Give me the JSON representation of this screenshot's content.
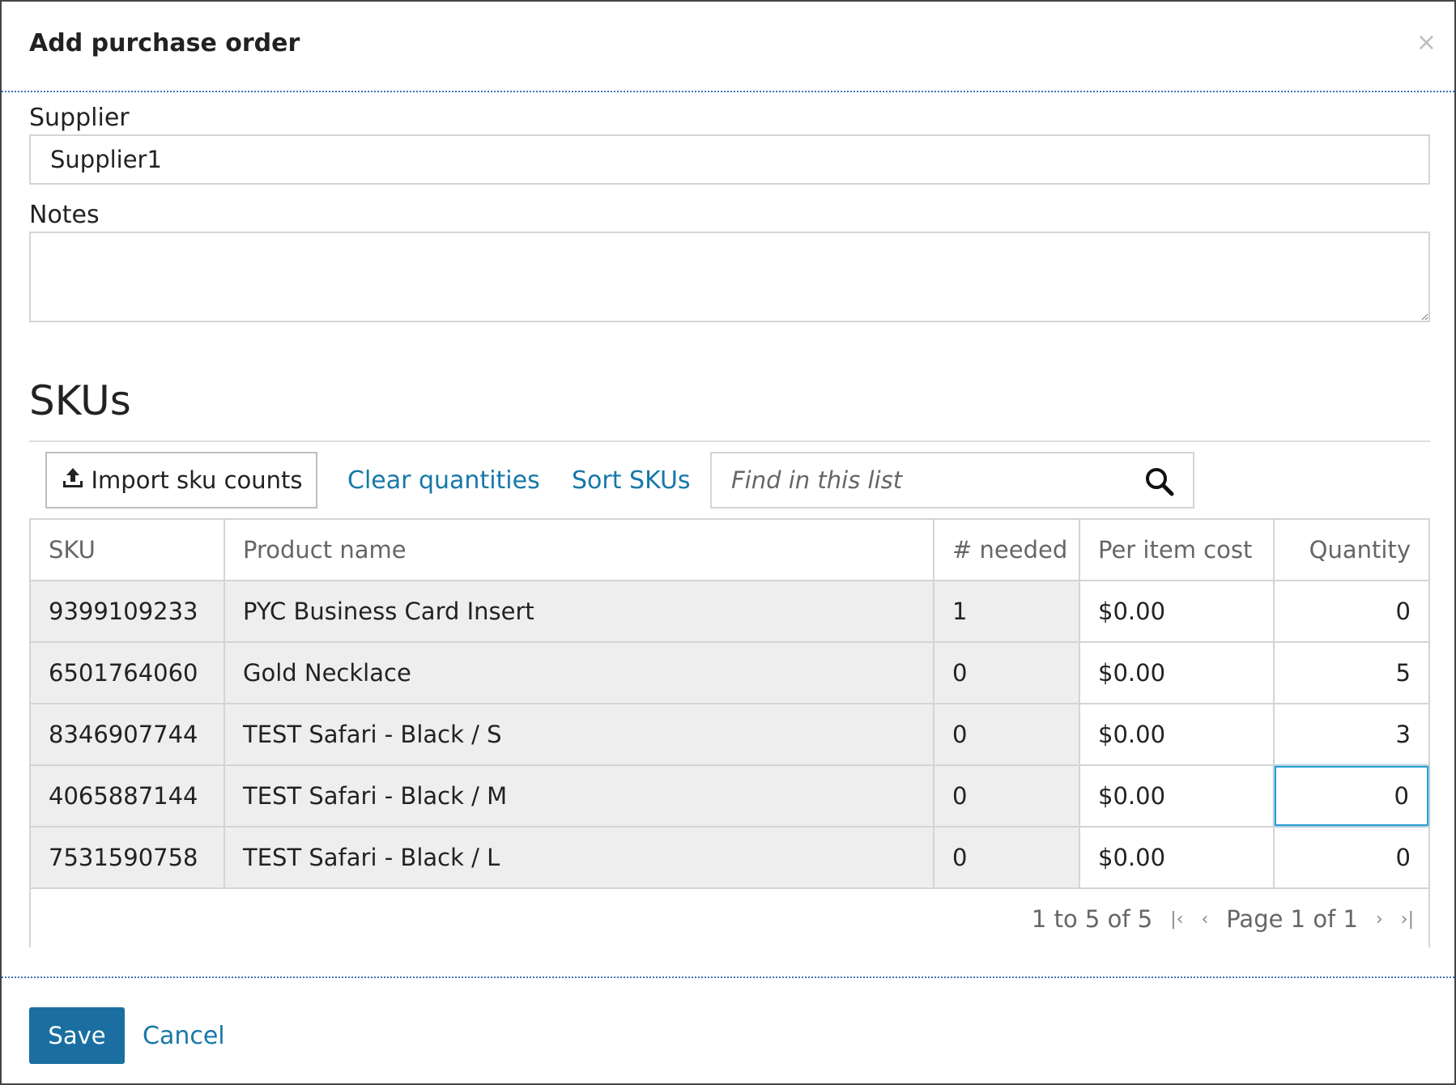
{
  "dialog": {
    "title": "Add purchase order",
    "close_symbol": "×"
  },
  "form": {
    "supplier_label": "Supplier",
    "supplier_value": "Supplier1",
    "notes_label": "Notes",
    "notes_value": ""
  },
  "skus": {
    "section_title": "SKUs",
    "toolbar": {
      "import_label": "Import sku counts",
      "clear_label": "Clear quantities",
      "sort_label": "Sort SKUs",
      "search_placeholder": "Find in this list"
    },
    "columns": [
      "SKU",
      "Product name",
      "# needed",
      "Per item cost",
      "Quantity"
    ],
    "rows": [
      {
        "sku": "9399109233",
        "name": "PYC Business Card Insert",
        "needed": "1",
        "cost": "$0.00",
        "qty": "0"
      },
      {
        "sku": "6501764060",
        "name": "Gold Necklace",
        "needed": "0",
        "cost": "$0.00",
        "qty": "5"
      },
      {
        "sku": "8346907744",
        "name": "TEST Safari - Black / S",
        "needed": "0",
        "cost": "$0.00",
        "qty": "3"
      },
      {
        "sku": "4065887144",
        "name": "TEST Safari - Black / M",
        "needed": "0",
        "cost": "$0.00",
        "qty": "0"
      },
      {
        "sku": "7531590758",
        "name": "TEST Safari - Black / L",
        "needed": "0",
        "cost": "$0.00",
        "qty": "0"
      }
    ],
    "pagination": {
      "summary": "1 to 5 of 5",
      "page_text": "Page 1 of 1",
      "first_symbol": "|‹",
      "prev_symbol": "‹",
      "next_symbol": "›",
      "last_symbol": "›|"
    }
  },
  "footer": {
    "save_label": "Save",
    "cancel_label": "Cancel"
  },
  "colors": {
    "primary": "#1a6fa0",
    "link": "#1778a8",
    "focus": "#2a9fd6",
    "readonly_cell": "#eeeeee"
  }
}
